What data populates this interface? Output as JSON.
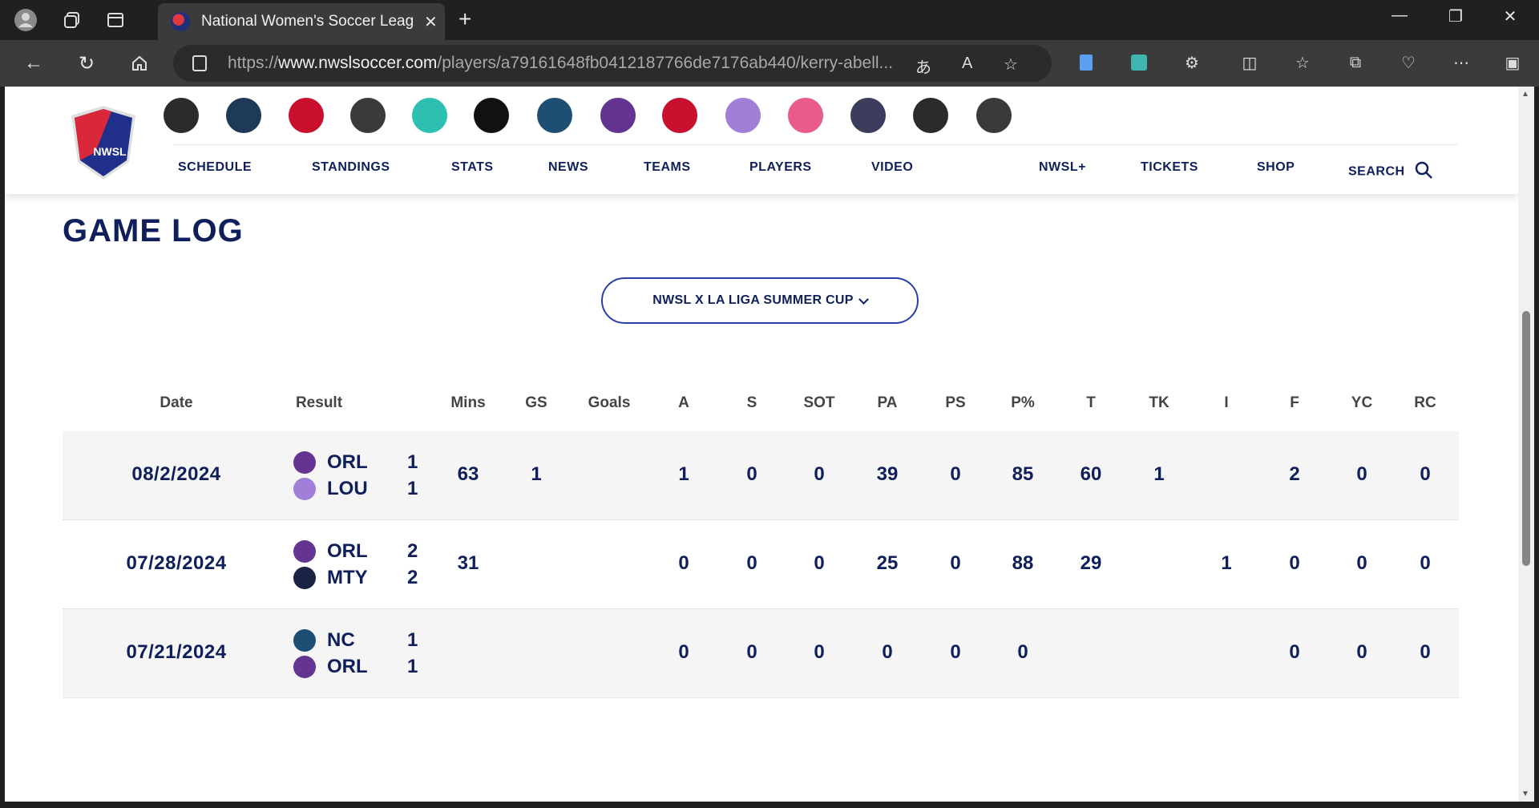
{
  "browser": {
    "tab_title": "National Women's Soccer League",
    "url_prefix": "https://",
    "url_domain": "www.nwslsoccer.com",
    "url_path": "/players/a79161648fb0412187766de7176ab440/kerry-abell..."
  },
  "site": {
    "logo_text": "NWSL",
    "nav": {
      "schedule": "SCHEDULE",
      "standings": "STANDINGS",
      "stats": "STATS",
      "news": "NEWS",
      "teams": "TEAMS",
      "players": "PLAYERS",
      "video": "VIDEO",
      "nwsl_plus": "NWSL+",
      "tickets": "TICKETS",
      "shop": "SHOP",
      "search": "SEARCH"
    },
    "clubs": [
      {
        "name": "angel-city",
        "color": "#2b2b2b"
      },
      {
        "name": "bay-fc",
        "color": "#1e3a57"
      },
      {
        "name": "chicago-red-stars",
        "color": "#c8102e"
      },
      {
        "name": "houston-dash",
        "color": "#3a3a3a"
      },
      {
        "name": "kc-current",
        "color": "#2dbfb0"
      },
      {
        "name": "gotham-fc",
        "color": "#111111"
      },
      {
        "name": "nc-courage",
        "color": "#1d4f74"
      },
      {
        "name": "orlando-pride",
        "color": "#633492"
      },
      {
        "name": "portland-thorns",
        "color": "#c8102e"
      },
      {
        "name": "racing-louisville",
        "color": "#a17fd8"
      },
      {
        "name": "san-diego-wave",
        "color": "#e85b8b"
      },
      {
        "name": "seattle-reign",
        "color": "#3c3c5c"
      },
      {
        "name": "utah-royals",
        "color": "#2b2b2b"
      },
      {
        "name": "washington-spirit",
        "color": "#3a3a3a"
      }
    ]
  },
  "game_log": {
    "title": "GAME LOG",
    "competition": "NWSL X LA LIGA SUMMER CUP",
    "headers": {
      "date": "Date",
      "result": "Result",
      "mins": "Mins",
      "gs": "GS",
      "goals": "Goals",
      "a": "A",
      "s": "S",
      "sot": "SOT",
      "pa": "PA",
      "ps": "PS",
      "pp": "P%",
      "t": "T",
      "tk": "TK",
      "i": "I",
      "f": "F",
      "yc": "YC",
      "rc": "RC"
    },
    "rows": [
      {
        "date": "08/2/2024",
        "home": "ORL",
        "home_score": "1",
        "away": "LOU",
        "away_score": "1",
        "home_color": "#633492",
        "away_color": "#a17fd8",
        "mins": "63",
        "gs": "1",
        "goals": "",
        "a": "1",
        "s": "0",
        "sot": "0",
        "pa": "39",
        "ps": "0",
        "pp": "85",
        "t": "60",
        "tk": "1",
        "i": "",
        "f": "2",
        "yc": "0",
        "rc": "0"
      },
      {
        "date": "07/28/2024",
        "home": "ORL",
        "home_score": "2",
        "away": "MTY",
        "away_score": "2",
        "home_color": "#633492",
        "away_color": "#1b2345",
        "mins": "31",
        "gs": "",
        "goals": "",
        "a": "0",
        "s": "0",
        "sot": "0",
        "pa": "25",
        "ps": "0",
        "pp": "88",
        "t": "29",
        "tk": "",
        "i": "1",
        "f": "0",
        "yc": "0",
        "rc": "0"
      },
      {
        "date": "07/21/2024",
        "home": "NC",
        "home_score": "1",
        "away": "ORL",
        "away_score": "1",
        "home_color": "#1d4f74",
        "away_color": "#633492",
        "mins": "",
        "gs": "",
        "goals": "",
        "a": "0",
        "s": "0",
        "sot": "0",
        "pa": "0",
        "ps": "0",
        "pp": "0",
        "t": "",
        "tk": "",
        "i": "",
        "f": "0",
        "yc": "0",
        "rc": "0"
      }
    ]
  }
}
